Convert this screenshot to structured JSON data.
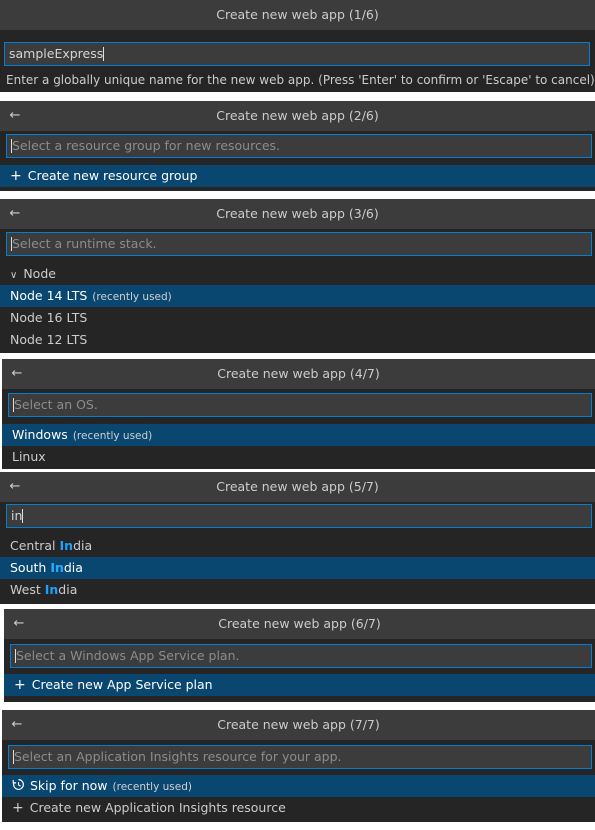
{
  "steps": [
    {
      "title": "Create new web app (1/6)",
      "input_value": "sampleExpress",
      "message": "Enter a globally unique name for the new web app. (Press 'Enter' to confirm or 'Escape' to cancel)"
    },
    {
      "title": "Create new web app (2/6)",
      "placeholder": "Select a resource group for new resources.",
      "items": [
        "Create new resource group"
      ]
    },
    {
      "title": "Create new web app (3/6)",
      "placeholder": "Select a runtime stack.",
      "group": "Node",
      "items": [
        {
          "label": "Node 14 LTS",
          "note": "(recently used)"
        },
        {
          "label": "Node 16 LTS"
        },
        {
          "label": "Node 12 LTS"
        }
      ]
    },
    {
      "title": "Create new web app (4/7)",
      "placeholder": "Select an OS.",
      "items": [
        {
          "label": "Windows",
          "note": "(recently used)"
        },
        {
          "label": "Linux"
        }
      ]
    },
    {
      "title": "Create new web app (5/7)",
      "input_value": "in",
      "items": [
        {
          "prefix": "Central ",
          "match": "In",
          "suffix": "dia"
        },
        {
          "prefix": "South ",
          "match": "In",
          "suffix": "dia"
        },
        {
          "prefix": "West ",
          "match": "In",
          "suffix": "dia"
        }
      ]
    },
    {
      "title": "Create new web app (6/7)",
      "placeholder": "Select a Windows App Service plan.",
      "items": [
        "Create new App Service plan"
      ]
    },
    {
      "title": "Create new web app (7/7)",
      "placeholder": "Select an Application Insights resource for your app.",
      "items": [
        {
          "label": "Skip for now",
          "note": "(recently used)"
        },
        {
          "label": "Create new Application Insights resource"
        }
      ]
    }
  ],
  "icons": {
    "back": "arrow-left-icon",
    "add": "plus-icon",
    "history": "history-icon",
    "chevron": "chevron-down-icon"
  },
  "colors": {
    "selection": "#094771",
    "focus_border": "#007fd4",
    "highlight": "#18a3ff"
  }
}
